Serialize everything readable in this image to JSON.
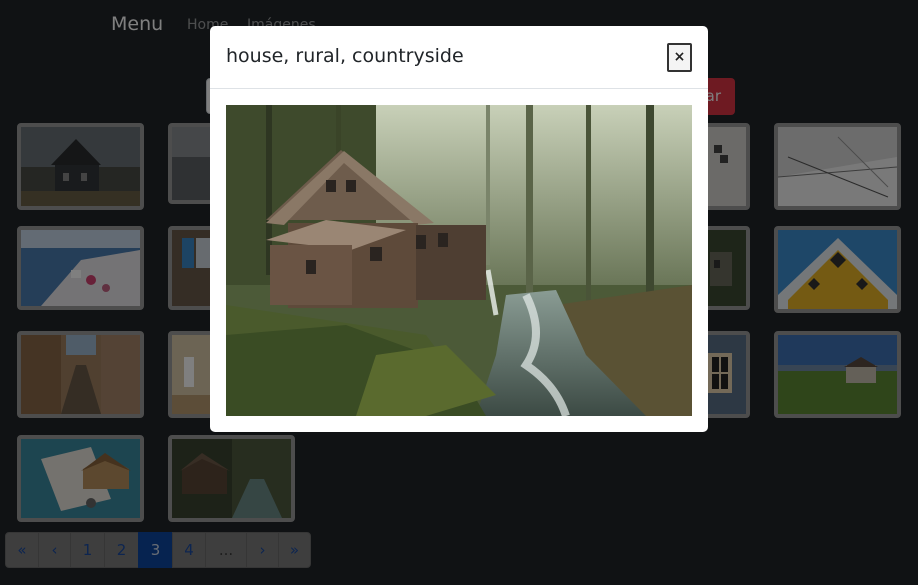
{
  "navbar": {
    "brand": "Menu",
    "links": [
      "Home",
      "Imágenes"
    ]
  },
  "search": {
    "placeholder": "",
    "button_label": "ar"
  },
  "gallery": {
    "images": [
      {
        "name": "dark-victorian-house"
      },
      {
        "name": "hidden-thumb-r1c2"
      },
      {
        "name": "hidden-thumb-r1c5"
      },
      {
        "name": "modern-interior-white"
      },
      {
        "name": "santorini-coast"
      },
      {
        "name": "blue-shutter-window"
      },
      {
        "name": "stone-house-green"
      },
      {
        "name": "yellow-cube-houses"
      },
      {
        "name": "narrow-old-street"
      },
      {
        "name": "empty-room-interior"
      },
      {
        "name": "window-blue-wall"
      },
      {
        "name": "field-small-house"
      },
      {
        "name": "wooden-house-model-keys"
      },
      {
        "name": "cedar-creek-mill"
      }
    ]
  },
  "pagination": {
    "items": [
      "«",
      "‹",
      "1",
      "2",
      "3",
      "4",
      "...",
      "›",
      "»"
    ],
    "active": "3"
  },
  "modal": {
    "title": "house, rural, countryside",
    "close_label": "×",
    "image_alt": "house, rural, countryside"
  },
  "colors": {
    "background": "#212529",
    "accent_button": "#dc3545",
    "active_page": "#0d47a1",
    "modal_bg": "#ffffff"
  }
}
